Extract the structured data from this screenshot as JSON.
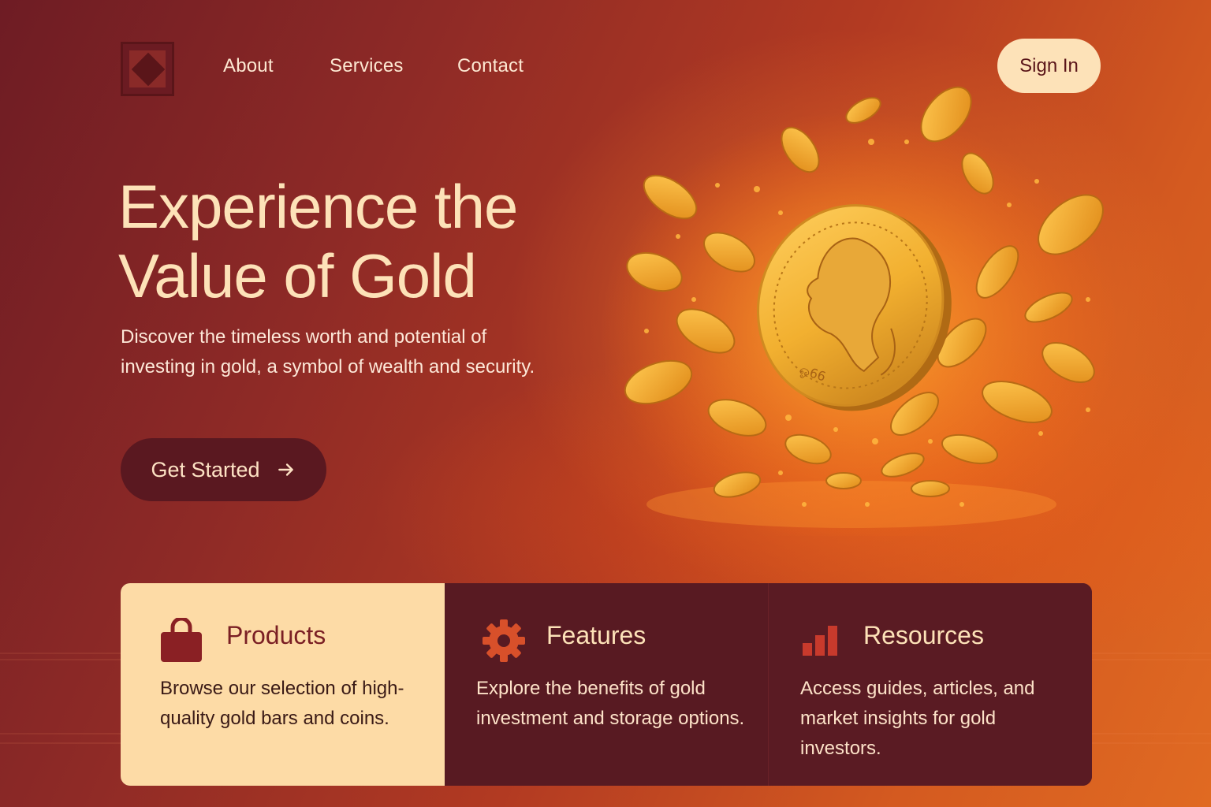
{
  "nav": {
    "logo": "logo-icon",
    "links": [
      "About",
      "Services",
      "Contact"
    ],
    "signin_label": "Sign In"
  },
  "hero": {
    "title_line1": "Experience the",
    "title_line2": "Value of Gold",
    "subtitle": "Discover the timeless worth and potential of investing in gold, a symbol of wealth and security.",
    "cta_label": "Get Started",
    "cta_icon": "arrow-right-icon"
  },
  "cards": [
    {
      "icon": "shopping-bag-icon",
      "title": "Products",
      "description": "Browse our selection of high-quality gold bars and coins."
    },
    {
      "icon": "gear-icon",
      "title": "Features",
      "description": "Explore the benefits of gold investment and storage options."
    },
    {
      "icon": "bar-chart-icon",
      "title": "Resources",
      "description": "Access guides, articles, and market insights for gold investors."
    }
  ],
  "colors": {
    "accent_cream": "#fde2b8",
    "dark_maroon": "#5a1820",
    "gold": "#f0a020",
    "background_start": "#6e1c24",
    "background_end": "#e06a22"
  }
}
